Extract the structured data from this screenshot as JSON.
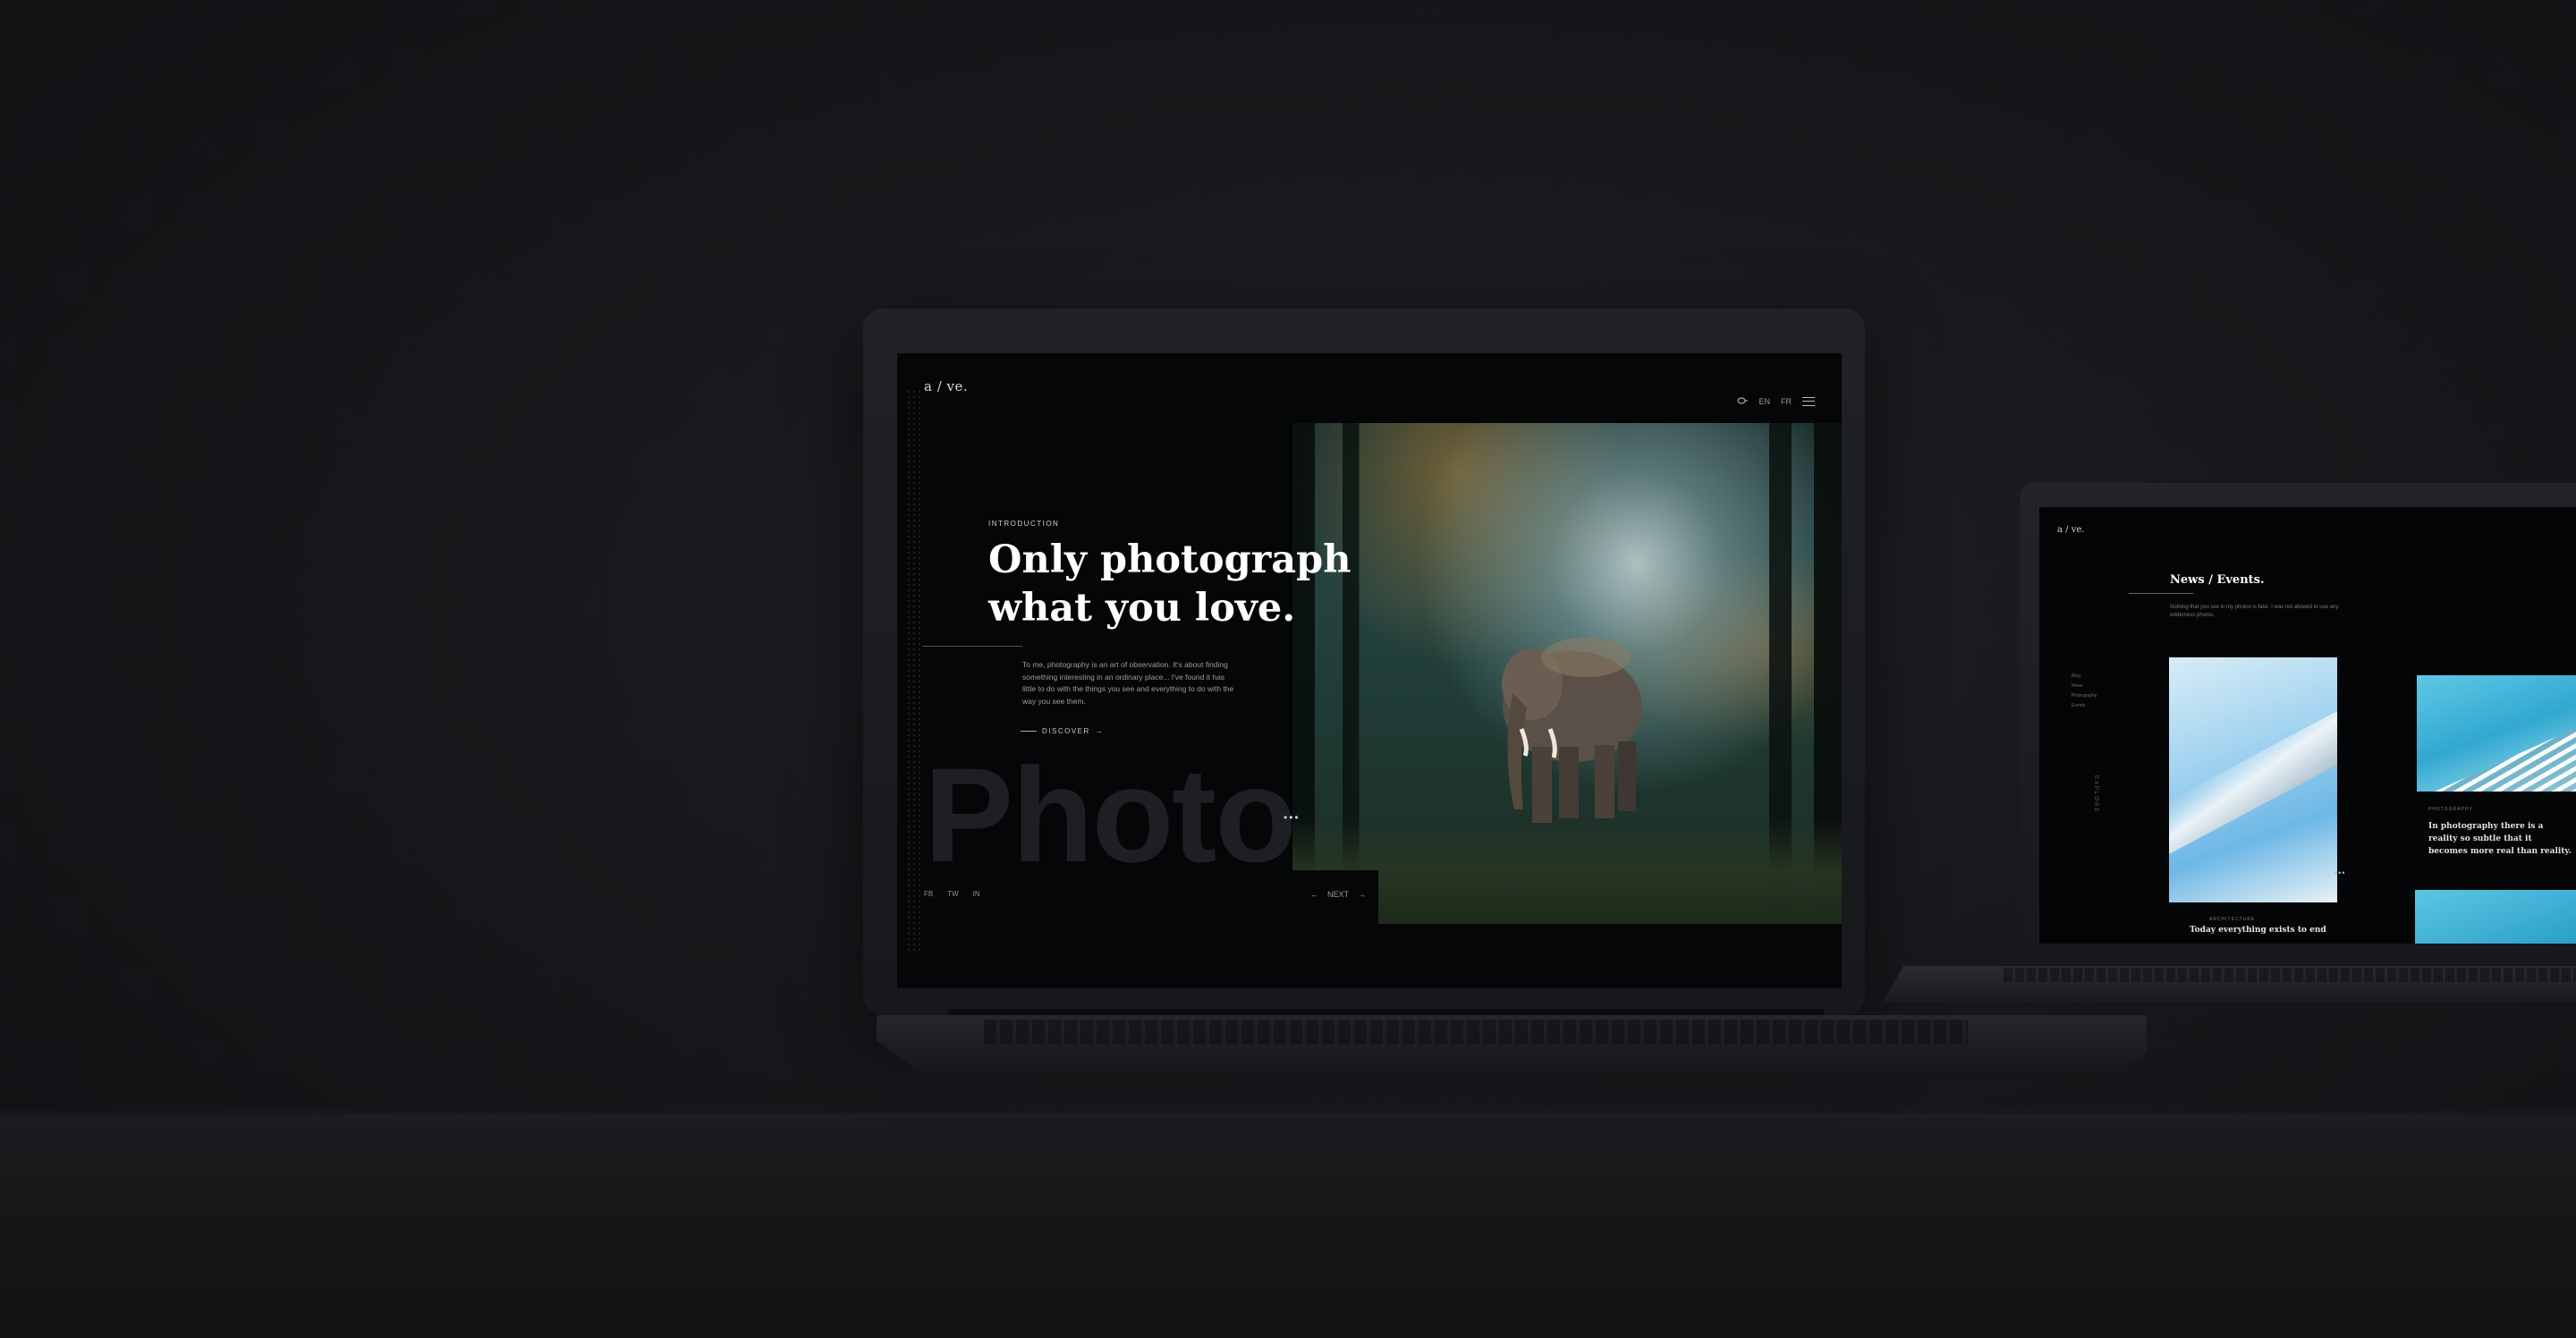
{
  "scene": {
    "background": "#17181b",
    "laptop_primary": {
      "logo": "a / ve.",
      "header_icons": [
        "search-icon",
        "language-en",
        "language-fr"
      ],
      "header_labels": [
        "EN",
        "FR"
      ],
      "intro_label": "INTRODUCTION",
      "title_line1": "Only photograph",
      "title_line2": "what you love.",
      "body": "To me, photography is an art of observation. It's about finding something interesting in an ordinary place... I've found it has little to do with the things you see and everything to do with the way you see them.",
      "discover_label": "DISCOVER",
      "ghost_word": "Photo",
      "slide_dots": "•••",
      "socials": [
        "FB",
        "TW",
        "IN"
      ],
      "pager_label": "NEXT",
      "accent": "#ffffff"
    },
    "laptop_secondary": {
      "logo": "a / ve.",
      "section_title": "News / Events.",
      "section_text": "Nothing that you see in my photos is fake. I was not allowed to use any wilderness photos.",
      "nav_items": [
        "Blog",
        "News",
        "Photography",
        "Events"
      ],
      "vertical_label": "EXPLORE",
      "card1_small": "ARCHITECTURE",
      "card1_caption": "Today everything exists to end",
      "card2_small": "PHOTOGRAPHY",
      "card2_caption": "In photography there is a reality so subtle that it becomes more real than reality.",
      "dots": "•••"
    }
  }
}
